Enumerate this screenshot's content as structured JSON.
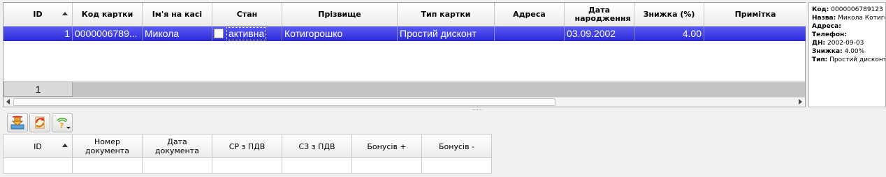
{
  "cards_grid": {
    "columns": [
      {
        "label": "ID",
        "sorted": "asc"
      },
      {
        "label": "Код картки"
      },
      {
        "label": "Ім'я на касі"
      },
      {
        "label": "Стан"
      },
      {
        "label": "Прізвище"
      },
      {
        "label": "Тип картки"
      },
      {
        "label": "Адреса"
      },
      {
        "label": "Дата народження"
      },
      {
        "label": "Знижка (%)"
      },
      {
        "label": "Примітка"
      }
    ],
    "rows": [
      {
        "id": "1",
        "card_code": "0000006789...",
        "cashier_name": "Микола",
        "state_checked": false,
        "state": "активна",
        "last_name": "Котигорошко",
        "card_type": "Простий дисконт",
        "address": "",
        "birth_date": "03.09.2002",
        "discount": "4.00",
        "note": ""
      }
    ],
    "footer_count": "1",
    "selected_color": "#2a2adc"
  },
  "card_info": {
    "code_label": "Код:",
    "code_value": "0000006789123",
    "name_label": "Назва:",
    "name_value": "Микола Котигорошко",
    "address_label": "Адреса:",
    "address_value": "",
    "phone_label": "Телефон:",
    "phone_value": "",
    "birthday_label": "ДН:",
    "birthday_value": "2002-09-03",
    "discount_label": "Знижка:",
    "discount_value": "4.00%",
    "type_label": "Тип:",
    "type_value": "Простий дисконт"
  },
  "toolbar": {
    "buttons": [
      {
        "icon": "import-arrow-icon"
      },
      {
        "icon": "refresh-icon"
      },
      {
        "icon": "wireless-help-icon",
        "dropdown": true
      }
    ]
  },
  "documents_grid": {
    "columns": [
      {
        "label": "ID",
        "sorted": "asc"
      },
      {
        "label": "Номер документа"
      },
      {
        "label": "Дата документа"
      },
      {
        "label": "СР з ПДВ"
      },
      {
        "label": "СЗ з ПДВ"
      },
      {
        "label": "Бонусів +"
      },
      {
        "label": "Бонусів -"
      }
    ]
  }
}
